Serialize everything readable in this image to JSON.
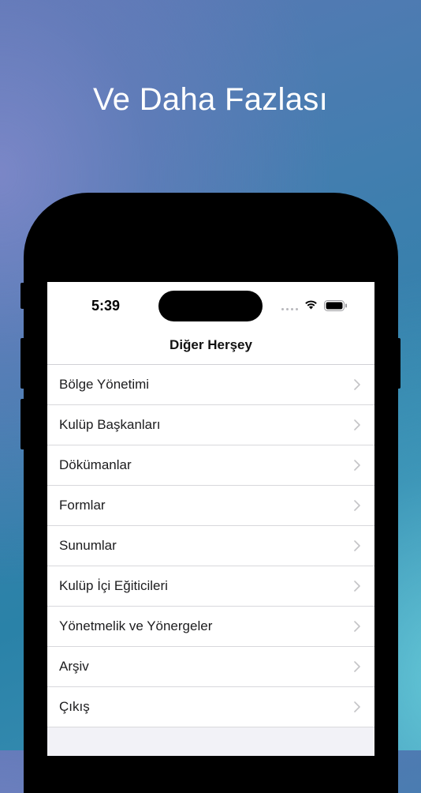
{
  "headline": "Ve Daha Fazlası",
  "status_bar": {
    "time": "5:39"
  },
  "nav": {
    "title": "Diğer Herşey"
  },
  "menu": {
    "items": [
      {
        "label": "Bölge Yönetimi"
      },
      {
        "label": "Kulüp Başkanları"
      },
      {
        "label": "Dökümanlar"
      },
      {
        "label": "Formlar"
      },
      {
        "label": "Sunumlar"
      },
      {
        "label": "Kulüp İçi Eğiticileri"
      },
      {
        "label": "Yönetmelik ve Yönergeler"
      },
      {
        "label": "Arşiv"
      },
      {
        "label": "Çıkış"
      }
    ]
  },
  "icons": {
    "row_accessory": "chevron-right-icon",
    "status": [
      "cellular-signal-icon",
      "wifi-icon",
      "battery-icon"
    ]
  },
  "colors": {
    "background_top_left": "#7b86c8",
    "background_main": "#2f80aa",
    "background_bottom_right": "#64c6d6",
    "screen_background": "#ffffff",
    "separator": "#d8d8dc",
    "chevron": "#c4c4c7"
  }
}
